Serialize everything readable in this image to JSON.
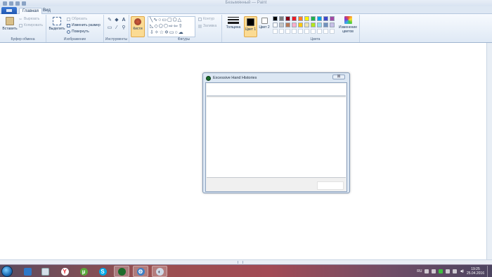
{
  "window": {
    "title": "Безымянный — Paint"
  },
  "tabs": [
    {
      "label": "Главная"
    },
    {
      "label": "Вид"
    }
  ],
  "ribbon": {
    "clipboard": {
      "label": "Буфер обмена",
      "paste": "Вставить",
      "cut": "Вырезать",
      "copy": "Копировать"
    },
    "image": {
      "label": "Изображение",
      "select": "Выделить",
      "crop": "Обрезать",
      "resize": "Изменить размер",
      "rotate": "Повернуть"
    },
    "tools": {
      "label": "Инструменты"
    },
    "brushes": {
      "label": "Кисти"
    },
    "shapes": {
      "label": "Фигуры",
      "outline": "Контур",
      "fill": "Заливка"
    },
    "size": {
      "label": "Толщина"
    },
    "color1": {
      "label": "Цвет 1",
      "value": "#000000"
    },
    "color2": {
      "label": "Цвет 2",
      "value": "#ffffff"
    },
    "colors": {
      "label": "Цвета",
      "edit": "Изменение цветов",
      "row1": [
        "#000000",
        "#7f7f7f",
        "#880015",
        "#ed1c24",
        "#ff7f27",
        "#fff200",
        "#22b14c",
        "#00a2e8",
        "#3f48cc",
        "#a349a4"
      ],
      "row2": [
        "#ffffff",
        "#c3c3c3",
        "#b97a57",
        "#ffaec9",
        "#ffc90e",
        "#efe4b0",
        "#b5e61d",
        "#99d9ea",
        "#7092be",
        "#c8bfe7"
      ]
    }
  },
  "dialog": {
    "title": "Excessive Hand Histories"
  },
  "taskbar": {
    "lang": "RU",
    "time": "19:25",
    "date": "25.04.2016"
  }
}
